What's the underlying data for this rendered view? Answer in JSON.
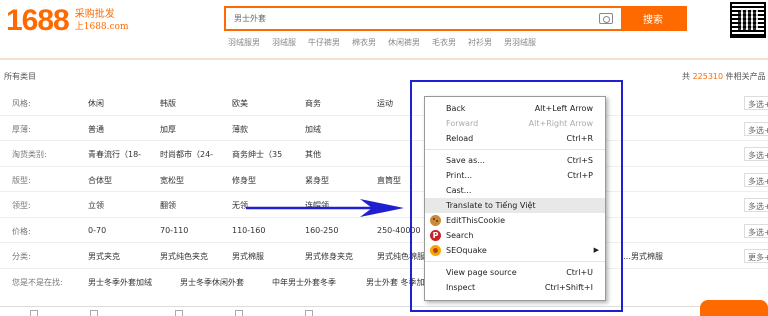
{
  "header": {
    "logo_number": "1688",
    "logo_cn": "采购批发",
    "logo_url": "上1688.com",
    "search_value": "男士外套",
    "search_button": "搜索",
    "hot_words": [
      "羽绒服男",
      "羽绒服",
      "牛仔裤男",
      "棉衣男",
      "休闲裤男",
      "毛衣男",
      "衬衫男",
      "男羽绒服"
    ]
  },
  "category_bar": {
    "all_categories": "所有类目",
    "count_prefix": "共 ",
    "count_number": "225310",
    "count_suffix": " 件相关产品"
  },
  "filters": [
    {
      "label": "风格:",
      "values": [
        "休闲",
        "韩版",
        "欧美",
        "商务",
        "运动"
      ],
      "multi": "多选+"
    },
    {
      "label": "厚薄:",
      "values": [
        "普通",
        "加厚",
        "薄款",
        "加绒"
      ],
      "multi": "多选+"
    },
    {
      "label": "淘货类别:",
      "values": [
        "青春流行（18-",
        "时尚都市（24-",
        "商务绅士（35",
        "其他"
      ],
      "multi": "多选+"
    },
    {
      "label": "版型:",
      "values": [
        "合体型",
        "宽松型",
        "修身型",
        "紧身型",
        "直筒型"
      ],
      "multi": "多选+"
    },
    {
      "label": "领型:",
      "values": [
        "立领",
        "翻领",
        "无领",
        "连帽领",
        ""
      ],
      "multi": "多选+"
    },
    {
      "label": "价格:",
      "values": [
        "0-70",
        "70-110",
        "110-160",
        "160-250",
        "250-40000"
      ],
      "multi": "多选+"
    },
    {
      "label": "分类:",
      "values": [
        "男式夹克",
        "男式纯色夹克",
        "男式棉服",
        "男式修身夹克",
        "男式纯色棉服",
        "…男式棉服"
      ],
      "multi": "更多+"
    },
    {
      "label": "您是不是在找:",
      "values": [
        "男士冬季外套加绒",
        "男士冬季休闲外套",
        "中年男士外套冬季",
        "男士外套 冬季加"
      ],
      "multi": ""
    }
  ],
  "context_menu": {
    "items": [
      {
        "label": "Back",
        "shortcut": "Alt+Left Arrow",
        "disabled": false
      },
      {
        "label": "Forward",
        "shortcut": "Alt+Right Arrow",
        "disabled": true
      },
      {
        "label": "Reload",
        "shortcut": "Ctrl+R",
        "disabled": false
      },
      {
        "label": "Save as...",
        "shortcut": "Ctrl+S",
        "disabled": false
      },
      {
        "label": "Print...",
        "shortcut": "Ctrl+P",
        "disabled": false
      },
      {
        "label": "Cast...",
        "shortcut": "",
        "disabled": false
      },
      {
        "label": "Translate to Tiếng Việt",
        "shortcut": "",
        "disabled": false
      },
      {
        "label": "EditThisCookie",
        "shortcut": "",
        "disabled": false
      },
      {
        "label": "Search",
        "shortcut": "",
        "disabled": false
      },
      {
        "label": "SEOquake",
        "shortcut": "",
        "disabled": false
      },
      {
        "label": "View page source",
        "shortcut": "Ctrl+U",
        "disabled": false
      },
      {
        "label": "Inspect",
        "shortcut": "Ctrl+Shift+I",
        "disabled": false
      }
    ]
  },
  "colors": {
    "brand": "#ff6a00",
    "annotation": "#2020d0"
  }
}
